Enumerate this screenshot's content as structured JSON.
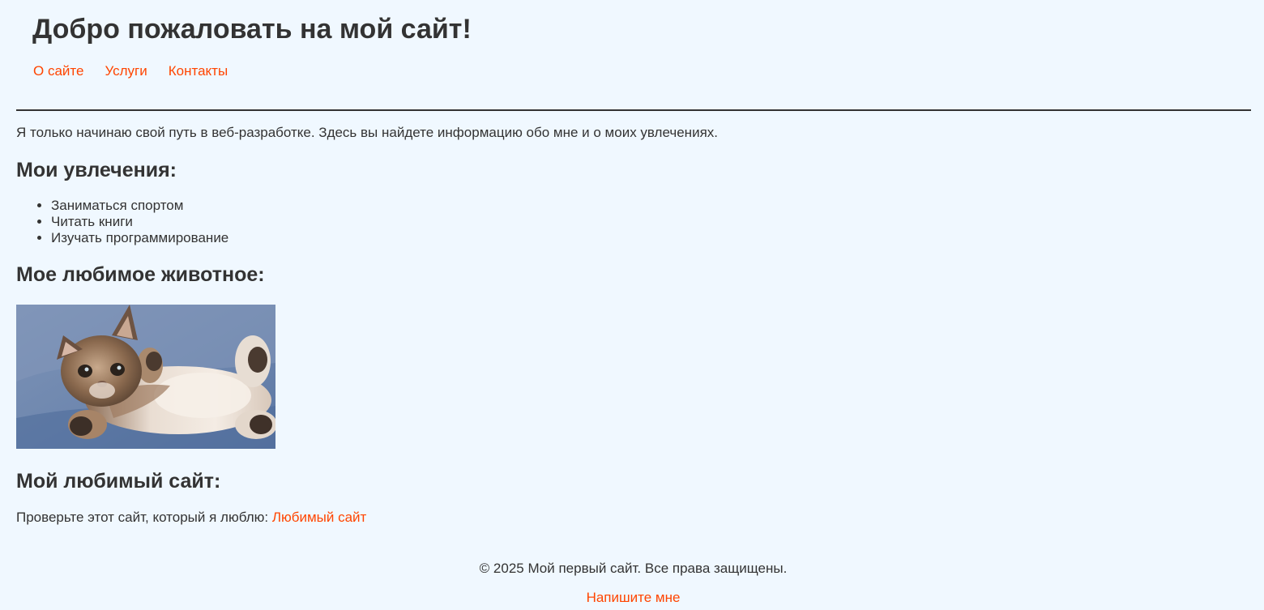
{
  "header": {
    "title": "Добро пожаловать на мой сайт!",
    "nav": [
      "О сайте",
      "Услуги",
      "Контакты"
    ]
  },
  "intro": "Я только начинаю свой путь в веб-разработке. Здесь вы найдете информацию обо мне и о моих увлечениях.",
  "hobbies": {
    "heading": "Мои увлечения:",
    "items": [
      "Заниматься спортом",
      "Читать книги",
      "Изучать программирование"
    ]
  },
  "animal": {
    "heading": "Мое любимое животное:",
    "image": "kitten-photo"
  },
  "favorite_site": {
    "heading": "Мой любимый сайт:",
    "text": "Проверьте этот сайт, который я люблю:",
    "link": "Любимый сайт"
  },
  "footer": {
    "copyright": "© 2025 Мой первый сайт. Все права защищены.",
    "contact_link": "Напишите мне"
  },
  "colors": {
    "background": "#f0f8ff",
    "text": "#333333",
    "link": "#ff4500"
  }
}
